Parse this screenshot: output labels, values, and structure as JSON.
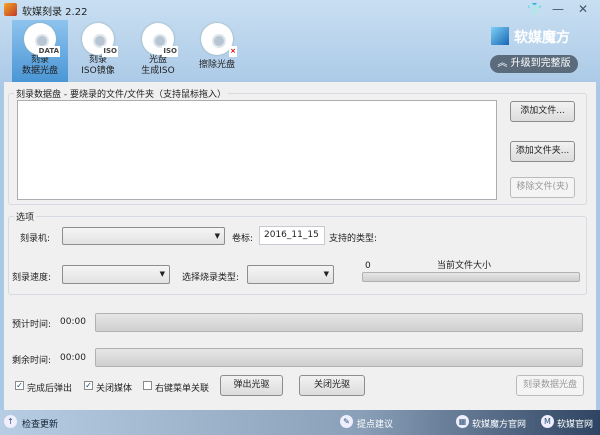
{
  "window": {
    "title": "软媒刻录 2.22"
  },
  "toolbar": [
    {
      "label1": "刻录",
      "label2": "数据光盘",
      "badge": "DATA"
    },
    {
      "label1": "刻录",
      "label2": "ISO镜像",
      "badge": "ISO"
    },
    {
      "label1": "光盘",
      "label2": "生成ISO",
      "badge": "ISO"
    },
    {
      "label1": "擦除光盘",
      "label2": "",
      "badge": "×"
    }
  ],
  "brand": {
    "name": "软媒魔方",
    "upgrade": "升级到完整版"
  },
  "files": {
    "group_label": "刻录数据盘 - 要烧录的文件/文件夹（支持鼠标拖入）",
    "add_file": "添加文件...",
    "add_folder": "添加文件夹...",
    "remove": "移除文件(夹)"
  },
  "options": {
    "group_label": "选项",
    "burner_label": "刻录机:",
    "volume_label": "卷标:",
    "volume_value": "2016_11_15",
    "supported_label": "支持的类型:",
    "speed_label": "刻录速度:",
    "type_label": "选择烧录类型:",
    "size_value": "0",
    "size_label": "当前文件大小",
    "size_progress": 0
  },
  "progress": {
    "est_label": "预计时间:",
    "est_value": "00:00",
    "est_progress": 0,
    "remain_label": "剩余时间:",
    "remain_value": "00:00",
    "remain_progress": 0
  },
  "bottom": {
    "eject_after": "完成后弹出",
    "close_media": "关闭媒体",
    "context_menu": "右键菜单关联",
    "eject_btn": "弹出光驱",
    "close_btn": "关闭光驱",
    "burn_btn": "刻录数据光盘"
  },
  "statusbar": {
    "update": "检查更新",
    "feedback": "提点建议",
    "mofang_site": "软媒魔方官网",
    "ruanmei_site": "软媒官网"
  }
}
